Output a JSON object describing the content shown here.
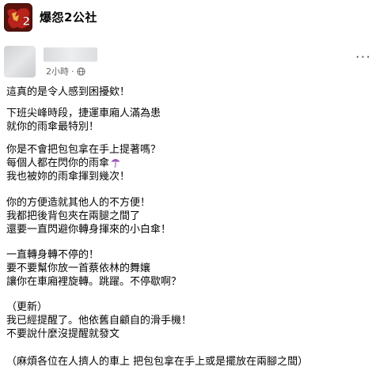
{
  "group": {
    "name": "爆怨2公社",
    "avatar_text": "2",
    "avatar_icon": "group-logo-icon"
  },
  "post": {
    "time": "2小時",
    "separator": "·",
    "privacy_icon": "globe-icon",
    "more_icon": "more-options-icon",
    "more_label": "···",
    "paragraphs": [
      {
        "lines": [
          "這真的是令人感到困擾欸！"
        ]
      },
      {
        "lines": [
          "下班尖峰時段，捷運車廂人滿為患",
          "就你的雨傘最特別！"
        ]
      },
      {
        "lines": [
          "你是不會把包包拿在手上提著嗎？",
          "每個人都在閃你的雨傘",
          "我也被妳的雨傘揮到幾次！"
        ]
      },
      {
        "lines": [
          "你的方便造就其他人的不方便！",
          "我都把後背包夾在兩腿之間了",
          "還要一直閃避你轉身揮來的小白傘！"
        ]
      },
      {
        "lines": [
          "一直轉身轉不停的！",
          "要不要幫你放一首蔡依林的舞孃",
          "讓你在車廂裡旋轉。跳躍。不停歇啊？"
        ]
      },
      {
        "lines": [
          "（更新）",
          "我已經提醒了。他依舊自顧自的滑手機！",
          "不要說什麼沒提醒就發文"
        ]
      },
      {
        "lines": [
          "（麻煩各位在人擠人的車上 把包包拿在手上或是擺放在兩腳之間）"
        ]
      }
    ],
    "umbrella_icon": "umbrella-icon",
    "umbrella_color": "#9b59b6"
  }
}
